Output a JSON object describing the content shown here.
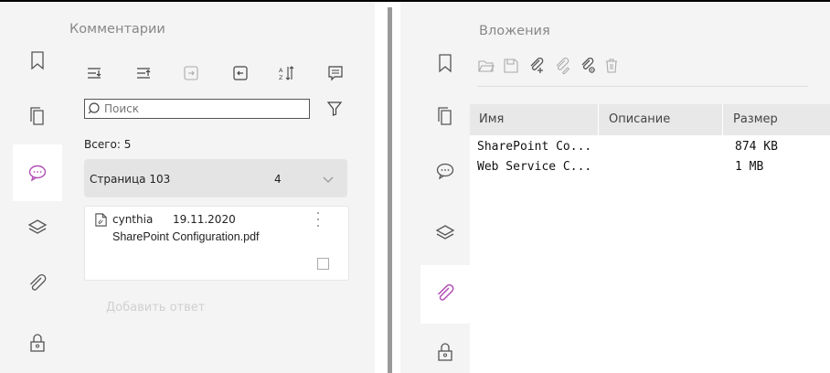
{
  "left_panel": {
    "title": "Комментарии",
    "search": {
      "placeholder": "Поиск",
      "value": "Поиск"
    },
    "total": "Всего: 5",
    "group": {
      "label": "Страница 103",
      "count": "4"
    },
    "comment": {
      "author": "cynthia",
      "date": "19.11.2020",
      "text": "SharePoint Configuration.pdf"
    },
    "reply_placeholder": "Добавить ответ"
  },
  "right_panel": {
    "title": "Вложения",
    "columns": [
      "Имя",
      "Описание",
      "Размер"
    ],
    "rows": [
      {
        "name": "SharePoint Co...",
        "description": "",
        "size": "874 KB"
      },
      {
        "name": "Web Service C...",
        "description": "",
        "size": "1 MB"
      }
    ]
  },
  "colors": {
    "accent": "#b14fb6",
    "panel_bg": "#f4f4f4",
    "header_bg": "#e8e8e8"
  },
  "icons": {
    "left_rail": [
      "bookmark-icon",
      "pages-icon",
      "comments-icon",
      "layers-icon",
      "attachments-icon",
      "security-lock-icon"
    ],
    "right_rail": [
      "bookmark-icon",
      "pages-icon",
      "comments-icon",
      "layers-icon",
      "attachments-icon",
      "security-lock-icon"
    ]
  }
}
